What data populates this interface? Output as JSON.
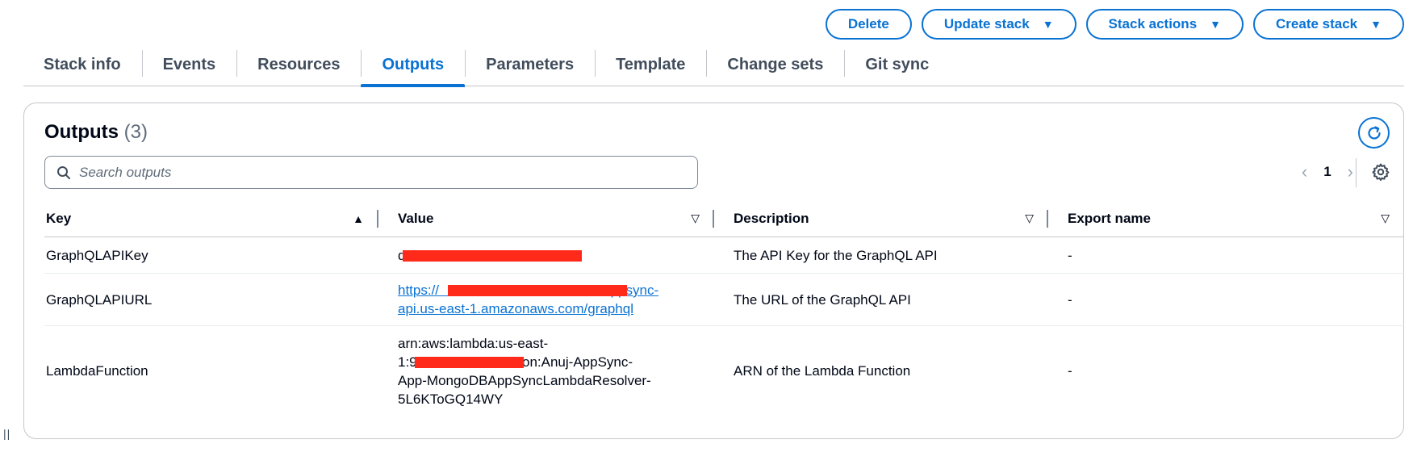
{
  "actions": {
    "delete": "Delete",
    "update_stack": "Update stack",
    "stack_actions": "Stack actions",
    "create_stack": "Create stack"
  },
  "tabs": [
    {
      "label": "Stack info"
    },
    {
      "label": "Events"
    },
    {
      "label": "Resources"
    },
    {
      "label": "Outputs",
      "active": true
    },
    {
      "label": "Parameters"
    },
    {
      "label": "Template"
    },
    {
      "label": "Change sets"
    },
    {
      "label": "Git sync"
    }
  ],
  "outputs": {
    "title": "Outputs",
    "count": "(3)",
    "search_placeholder": "Search outputs",
    "page": "1",
    "columns": {
      "key": "Key",
      "value": "Value",
      "description": "Description",
      "export": "Export name"
    },
    "rows": [
      {
        "key": "GraphQLAPIKey",
        "value": "d                                  e",
        "description": "The API Key for the GraphQL API",
        "export": "-"
      },
      {
        "key": "GraphQLAPIURL",
        "value": "https://                                           appsync-api.us-east-1.amazonaws.com/graphql",
        "description": "The URL of the GraphQL API",
        "export": "-"
      },
      {
        "key": "LambdaFunction",
        "value_line1": "arn:aws:lambda:us-east-",
        "value_line2": "1:9                  :function:Anuj-AppSync-",
        "value_line3": "App-MongoDBAppSyncLambdaResolver-",
        "value_line4": "5L6KToGQ14WY",
        "description": "ARN of the Lambda Function",
        "export": "-"
      }
    ]
  },
  "colors": {
    "accent": "#0972d3",
    "redaction": "#ff2a1a"
  }
}
